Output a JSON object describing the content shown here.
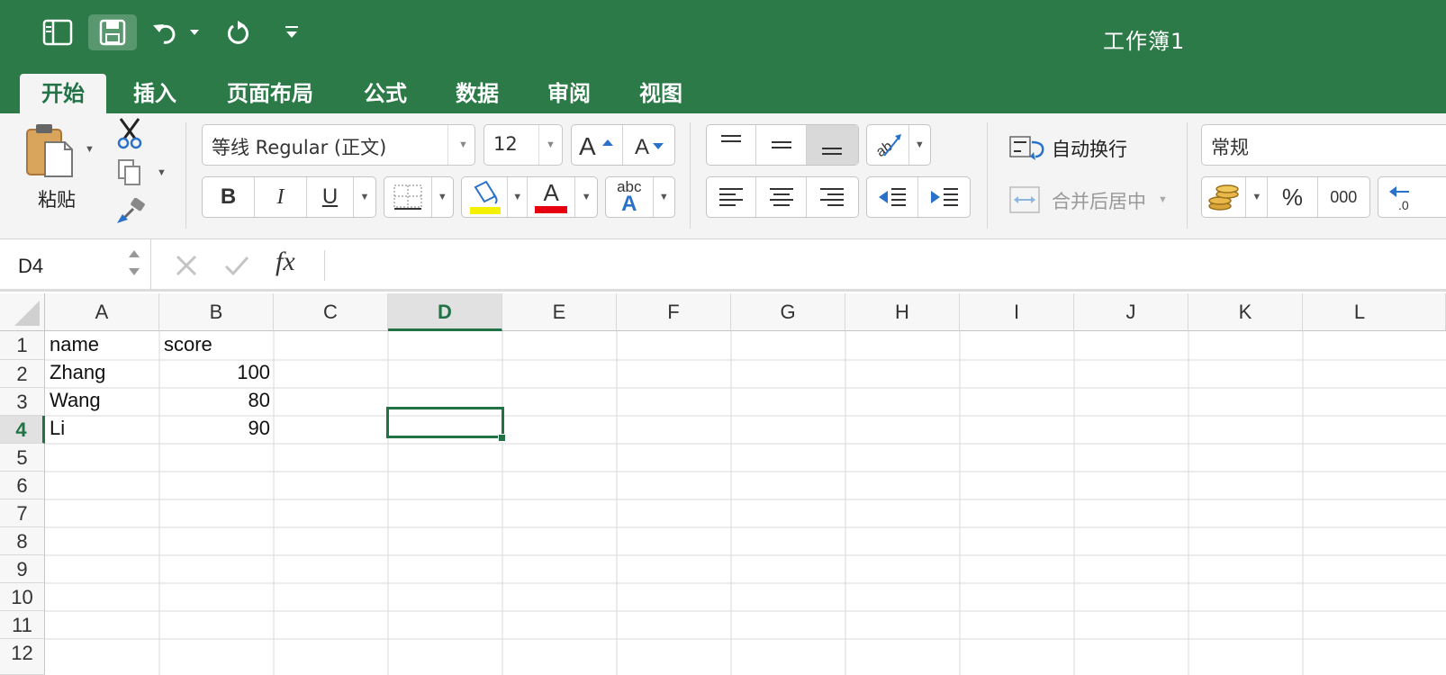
{
  "window": {
    "title": "工作簿1"
  },
  "tabs": [
    {
      "label": "开始",
      "active": true
    },
    {
      "label": "插入"
    },
    {
      "label": "页面布局"
    },
    {
      "label": "公式"
    },
    {
      "label": "数据"
    },
    {
      "label": "审阅"
    },
    {
      "label": "视图"
    }
  ],
  "ribbon": {
    "paste_label": "粘贴",
    "font_name": "等线 Regular (正文)",
    "font_size": "12",
    "bold": "B",
    "italic": "I",
    "underline": "U",
    "font_color_letter": "A",
    "phonetic_top": "abc",
    "phonetic_bottom": "A",
    "wrap_text_label": "自动换行",
    "merge_center_label": "合并后居中",
    "number_format": "常规",
    "percent_label": "%",
    "comma_label": "000",
    "highlight_color": "#f5f000",
    "font_color": "#e6000f"
  },
  "formula_bar": {
    "name_box": "D4",
    "fx_label": "fx",
    "formula": ""
  },
  "sheet": {
    "columns": [
      "A",
      "B",
      "C",
      "D",
      "E",
      "F",
      "G",
      "H",
      "I",
      "J",
      "K",
      "L"
    ],
    "rows": [
      "1",
      "2",
      "3",
      "4",
      "5",
      "6",
      "7",
      "8",
      "9",
      "10",
      "11",
      "12"
    ],
    "selected_cell": "D4",
    "cells": {
      "A1": "name",
      "B1": "score",
      "A2": "Zhang",
      "B2": "100",
      "A3": "Wang",
      "B3": "80",
      "A4": "Li",
      "B4": "90"
    }
  },
  "colors": {
    "accent": "#217346",
    "title_bar": "#2b7a47"
  }
}
